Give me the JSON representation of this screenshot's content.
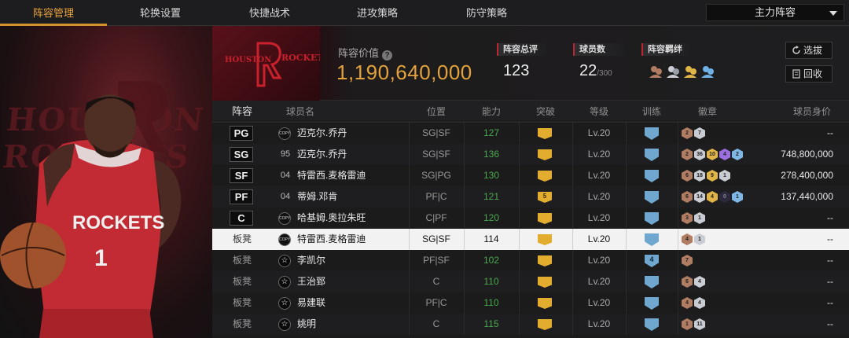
{
  "tabs": [
    {
      "label": "阵容管理",
      "active": true
    },
    {
      "label": "轮换设置",
      "active": false
    },
    {
      "label": "快捷战术",
      "active": false
    },
    {
      "label": "进攻策略",
      "active": false
    },
    {
      "label": "防守策略",
      "active": false
    }
  ],
  "lineup_select": {
    "value": "主力阵容"
  },
  "colors": {
    "accent": "#e3a23b",
    "tab_underline": "#d4922c",
    "team_red": "#c02632",
    "ability_green": "#4aa84e"
  },
  "team": {
    "logo_text": "ROCKETS",
    "logo_city": "HOUSTON",
    "player_number": "1"
  },
  "summary": {
    "value_label": "阵容价值",
    "value": "1,190,640,000",
    "rating_label": "阵容总评",
    "rating": "123",
    "player_count_label": "球员数",
    "player_count": "22",
    "player_count_max": "/300",
    "bond_label": "阵容羁绊"
  },
  "buttons": {
    "pick": "选拔",
    "recycle": "回收"
  },
  "table": {
    "headers": [
      "阵容",
      "球员名",
      "位置",
      "能力",
      "突破",
      "等级",
      "训练",
      "徽章",
      "球员身价"
    ],
    "rows": [
      {
        "slot": "PG",
        "tag": "COPY",
        "name": "迈克尔.乔丹",
        "position": "SG|SF",
        "ability": "127",
        "breakthrough": "",
        "level": "Lv.20",
        "training": "",
        "badges": [
          {
            "c": "b-bronze",
            "t": "2"
          },
          {
            "c": "b-silver",
            "t": "7"
          }
        ],
        "price": "--"
      },
      {
        "slot": "SG",
        "tag": "95",
        "name": "迈克尔.乔丹",
        "position": "SG|SF",
        "ability": "136",
        "breakthrough": "",
        "level": "Lv.20",
        "training": "",
        "badges": [
          {
            "c": "b-bronze",
            "t": "2"
          },
          {
            "c": "b-silver",
            "t": "36"
          },
          {
            "c": "b-gold",
            "t": "10"
          },
          {
            "c": "b-purple",
            "t": "4"
          },
          {
            "c": "b-blue",
            "t": "2"
          }
        ],
        "price": "748,800,000"
      },
      {
        "slot": "SF",
        "tag": "04",
        "name": "特雷西.麦格雷迪",
        "position": "SG|PG",
        "ability": "130",
        "breakthrough": "",
        "level": "Lv.20",
        "training": "",
        "badges": [
          {
            "c": "b-bronze",
            "t": "6"
          },
          {
            "c": "b-silver",
            "t": "18"
          },
          {
            "c": "b-gold",
            "t": "9"
          },
          {
            "c": "b-silver",
            "t": "1"
          }
        ],
        "price": "278,400,000"
      },
      {
        "slot": "PF",
        "tag": "04",
        "name": "蒂姆.邓肯",
        "position": "PF|C",
        "ability": "121",
        "breakthrough": "5",
        "level": "Lv.20",
        "training": "",
        "badges": [
          {
            "c": "b-bronze",
            "t": "6"
          },
          {
            "c": "b-silver",
            "t": "14"
          },
          {
            "c": "b-gold",
            "t": "4"
          },
          {
            "c": "b-dark",
            "t": "0"
          },
          {
            "c": "b-blue",
            "t": "1"
          }
        ],
        "price": "137,440,000"
      },
      {
        "slot": "C",
        "tag": "COPY",
        "name": "哈基姆.奥拉朱旺",
        "position": "C|PF",
        "ability": "120",
        "breakthrough": "",
        "level": "Lv.20",
        "training": "",
        "badges": [
          {
            "c": "b-bronze",
            "t": "3"
          },
          {
            "c": "b-silver",
            "t": "1"
          }
        ],
        "price": "--"
      },
      {
        "slot": "板凳",
        "tag": "COPY",
        "name": "特雷西.麦格雷迪",
        "position": "SG|SF",
        "ability": "114",
        "breakthrough": "",
        "level": "Lv.20",
        "training": "",
        "badges": [
          {
            "c": "b-bronze",
            "t": "4"
          },
          {
            "c": "b-silver",
            "t": "1"
          }
        ],
        "price": "--"
      },
      {
        "slot": "板凳",
        "tag": "STAR",
        "name": "李凯尔",
        "position": "PF|SF",
        "ability": "102",
        "breakthrough": "",
        "level": "Lv.20",
        "training": "4",
        "badges": [
          {
            "c": "b-bronze",
            "t": "7"
          }
        ],
        "price": "--"
      },
      {
        "slot": "板凳",
        "tag": "STAR",
        "name": "王治郅",
        "position": "C",
        "ability": "110",
        "breakthrough": "",
        "level": "Lv.20",
        "training": "",
        "badges": [
          {
            "c": "b-bronze",
            "t": "6"
          },
          {
            "c": "b-silver",
            "t": "4"
          }
        ],
        "price": "--"
      },
      {
        "slot": "板凳",
        "tag": "STAR",
        "name": "易建联",
        "position": "PF|C",
        "ability": "110",
        "breakthrough": "",
        "level": "Lv.20",
        "training": "",
        "badges": [
          {
            "c": "b-bronze",
            "t": "4"
          },
          {
            "c": "b-silver",
            "t": "4"
          }
        ],
        "price": "--"
      },
      {
        "slot": "板凳",
        "tag": "STAR",
        "name": "姚明",
        "position": "C",
        "ability": "115",
        "breakthrough": "",
        "level": "Lv.20",
        "training": "",
        "badges": [
          {
            "c": "b-bronze",
            "t": "1"
          },
          {
            "c": "b-silver",
            "t": "11"
          }
        ],
        "price": "--"
      }
    ]
  }
}
